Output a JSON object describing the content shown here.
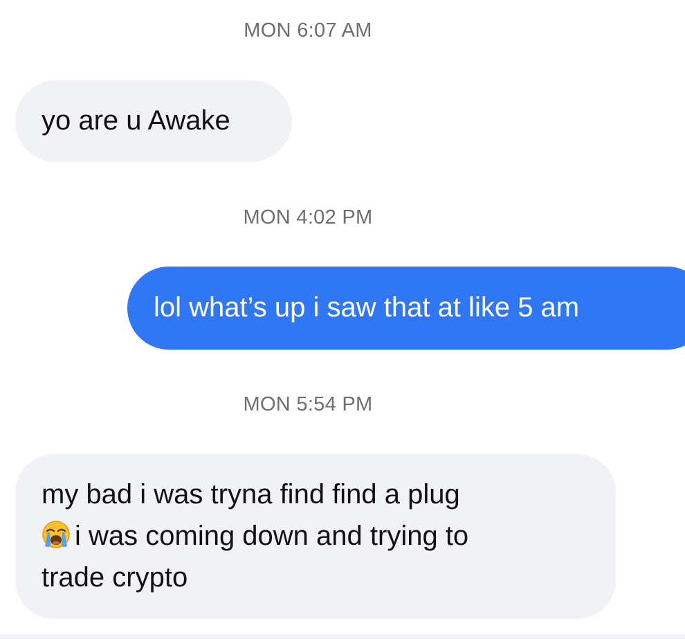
{
  "thread": {
    "messages": [
      {
        "timestamp": "MON 6:07 AM",
        "direction": "incoming",
        "text": "yo are u Awake"
      },
      {
        "timestamp": "MON 4:02 PM",
        "direction": "outgoing",
        "text": "lol what’s up i saw that at like 5 am"
      },
      {
        "timestamp": "MON 5:54 PM",
        "direction": "incoming",
        "text_line1": "my bad i was tryna find find a plug",
        "emoji": "loudly-crying-face-emoji",
        "text_after_emoji": "i was coming down and trying to",
        "text_line3": "trade crypto"
      }
    ]
  },
  "colors": {
    "incoming_bubble": "#f1f2f5",
    "outgoing_bubble": "#2f77f5",
    "timestamp_text": "#6d6d72"
  }
}
